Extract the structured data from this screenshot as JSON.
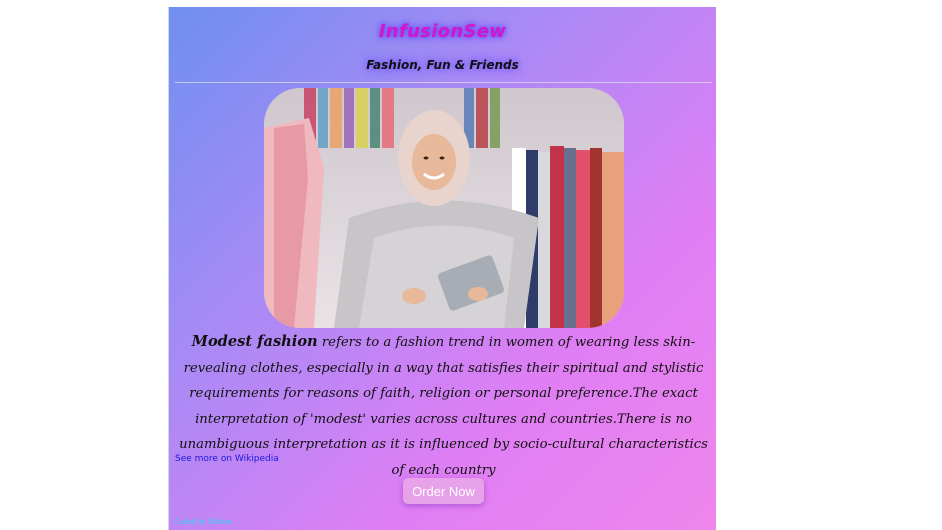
{
  "header": {
    "brand": "InfusionSew",
    "tagline": "Fashion, Fun & Friends"
  },
  "hero": {
    "image_subject": "woman in hijab holding a tablet in a clothing boutique"
  },
  "content": {
    "term": "Modest fashion",
    "description": " refers to a fashion trend in women of wearing less skin-revealing clothes, especially in a way that satisfies their spiritual and stylistic requirements for reasons of faith, religion or personal preference.The exact interpretation of 'modest' varies across cultures and countries.There is no unambiguous interpretation as it is influenced by socio-cultural characteristics of each country",
    "wiki_link": "See more on Wikipedia"
  },
  "cta": {
    "order_label": "Order Now"
  },
  "footer": {
    "credit": "Coded by Shibtan"
  },
  "colors": {
    "gradient_start": "#6f8ff0",
    "gradient_end": "#ef86ec",
    "brand": "#d018c8",
    "button": "#e7a2e9",
    "link": "#1a1adf",
    "credit": "#2fd8ef"
  }
}
